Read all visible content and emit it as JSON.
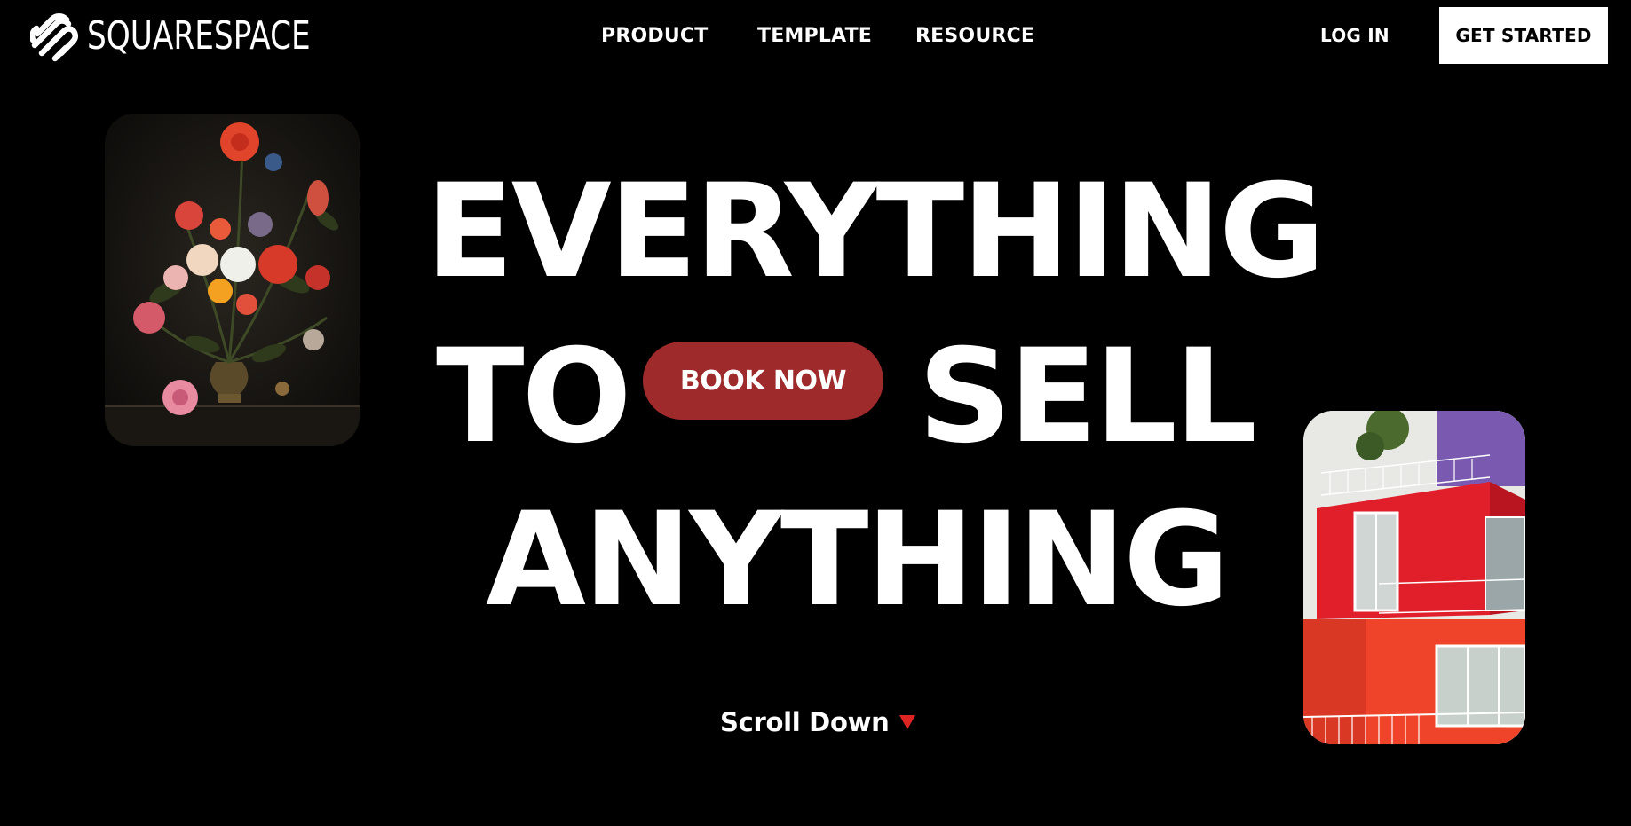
{
  "header": {
    "logo_text": "SQUARESPACE",
    "nav": {
      "product": "PRODUCT",
      "template": "TEMPLATE",
      "resource": "RESOURCE"
    },
    "login": "LOG IN",
    "cta": "GET STARTED"
  },
  "hero": {
    "line1": "EVERYTHING",
    "line2_left": "TO",
    "line2_right": "SELL",
    "line3": "ANYTHING",
    "book_now": "BOOK NOW",
    "scroll_down": "Scroll Down"
  },
  "icons": {
    "logo": "squarespace-logo-icon",
    "scroll": "triangle-down-icon"
  },
  "colors": {
    "background": "#000000",
    "text": "#ffffff",
    "book_now_bg": "#9e2a2b",
    "scroll_arrow": "#e02424",
    "cta_bg": "#ffffff",
    "cta_text": "#000000"
  }
}
